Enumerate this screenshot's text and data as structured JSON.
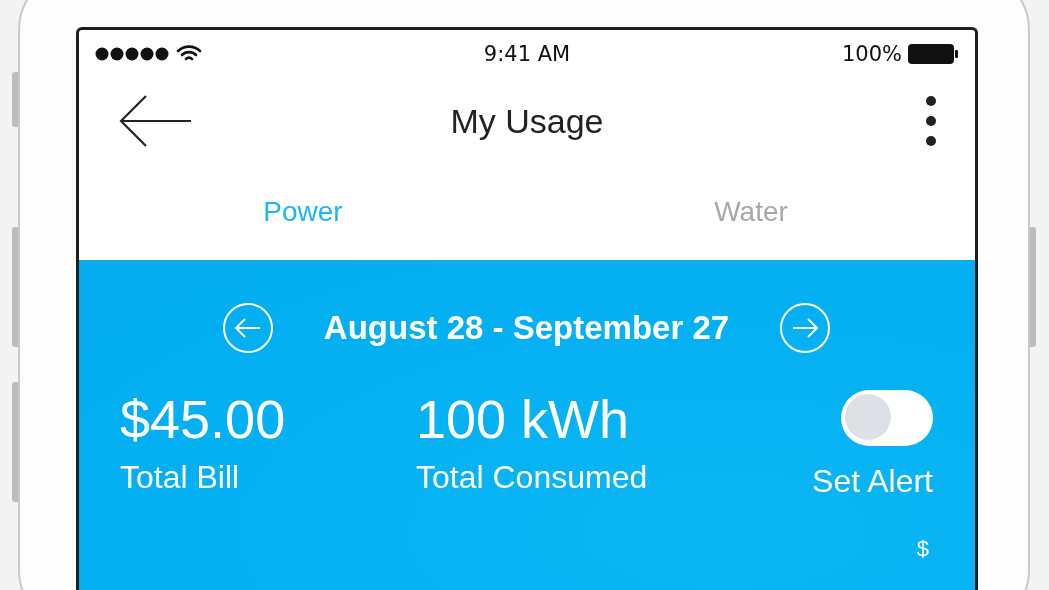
{
  "status_bar": {
    "time": "9:41 AM",
    "battery": "100%"
  },
  "header": {
    "title": "My Usage"
  },
  "tabs": [
    {
      "label": "Power",
      "selected": true
    },
    {
      "label": "Water",
      "selected": false
    }
  ],
  "period": {
    "range": "August 28 - September 27"
  },
  "stats": [
    {
      "value": "$45.00",
      "label": "Total Bill"
    },
    {
      "value": "100 kWh",
      "label": "Total Consumed"
    }
  ],
  "alert": {
    "label": "Set Alert",
    "on": false
  },
  "axis_label": "$"
}
